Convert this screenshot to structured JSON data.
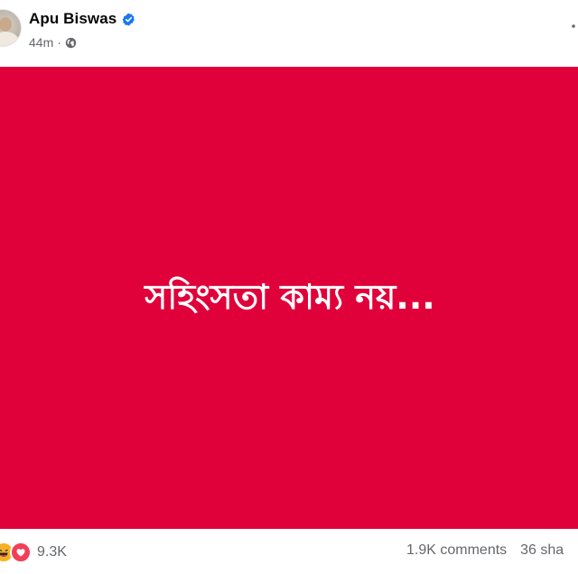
{
  "post": {
    "author": {
      "name": "Apu Biswas",
      "verified": true
    },
    "timestamp": "44m",
    "privacy_icon": "globe-icon",
    "media": {
      "text": "সহিংসতা কাম্য নয়...",
      "background_color": "#e0003a"
    },
    "engagement": {
      "reactions": [
        "haha",
        "love"
      ],
      "reaction_count": "9.3K",
      "comments": "1.9K comments",
      "shares": "36 sha"
    }
  },
  "colors": {
    "accent": "#1877f2",
    "muted_text": "#65676b"
  }
}
